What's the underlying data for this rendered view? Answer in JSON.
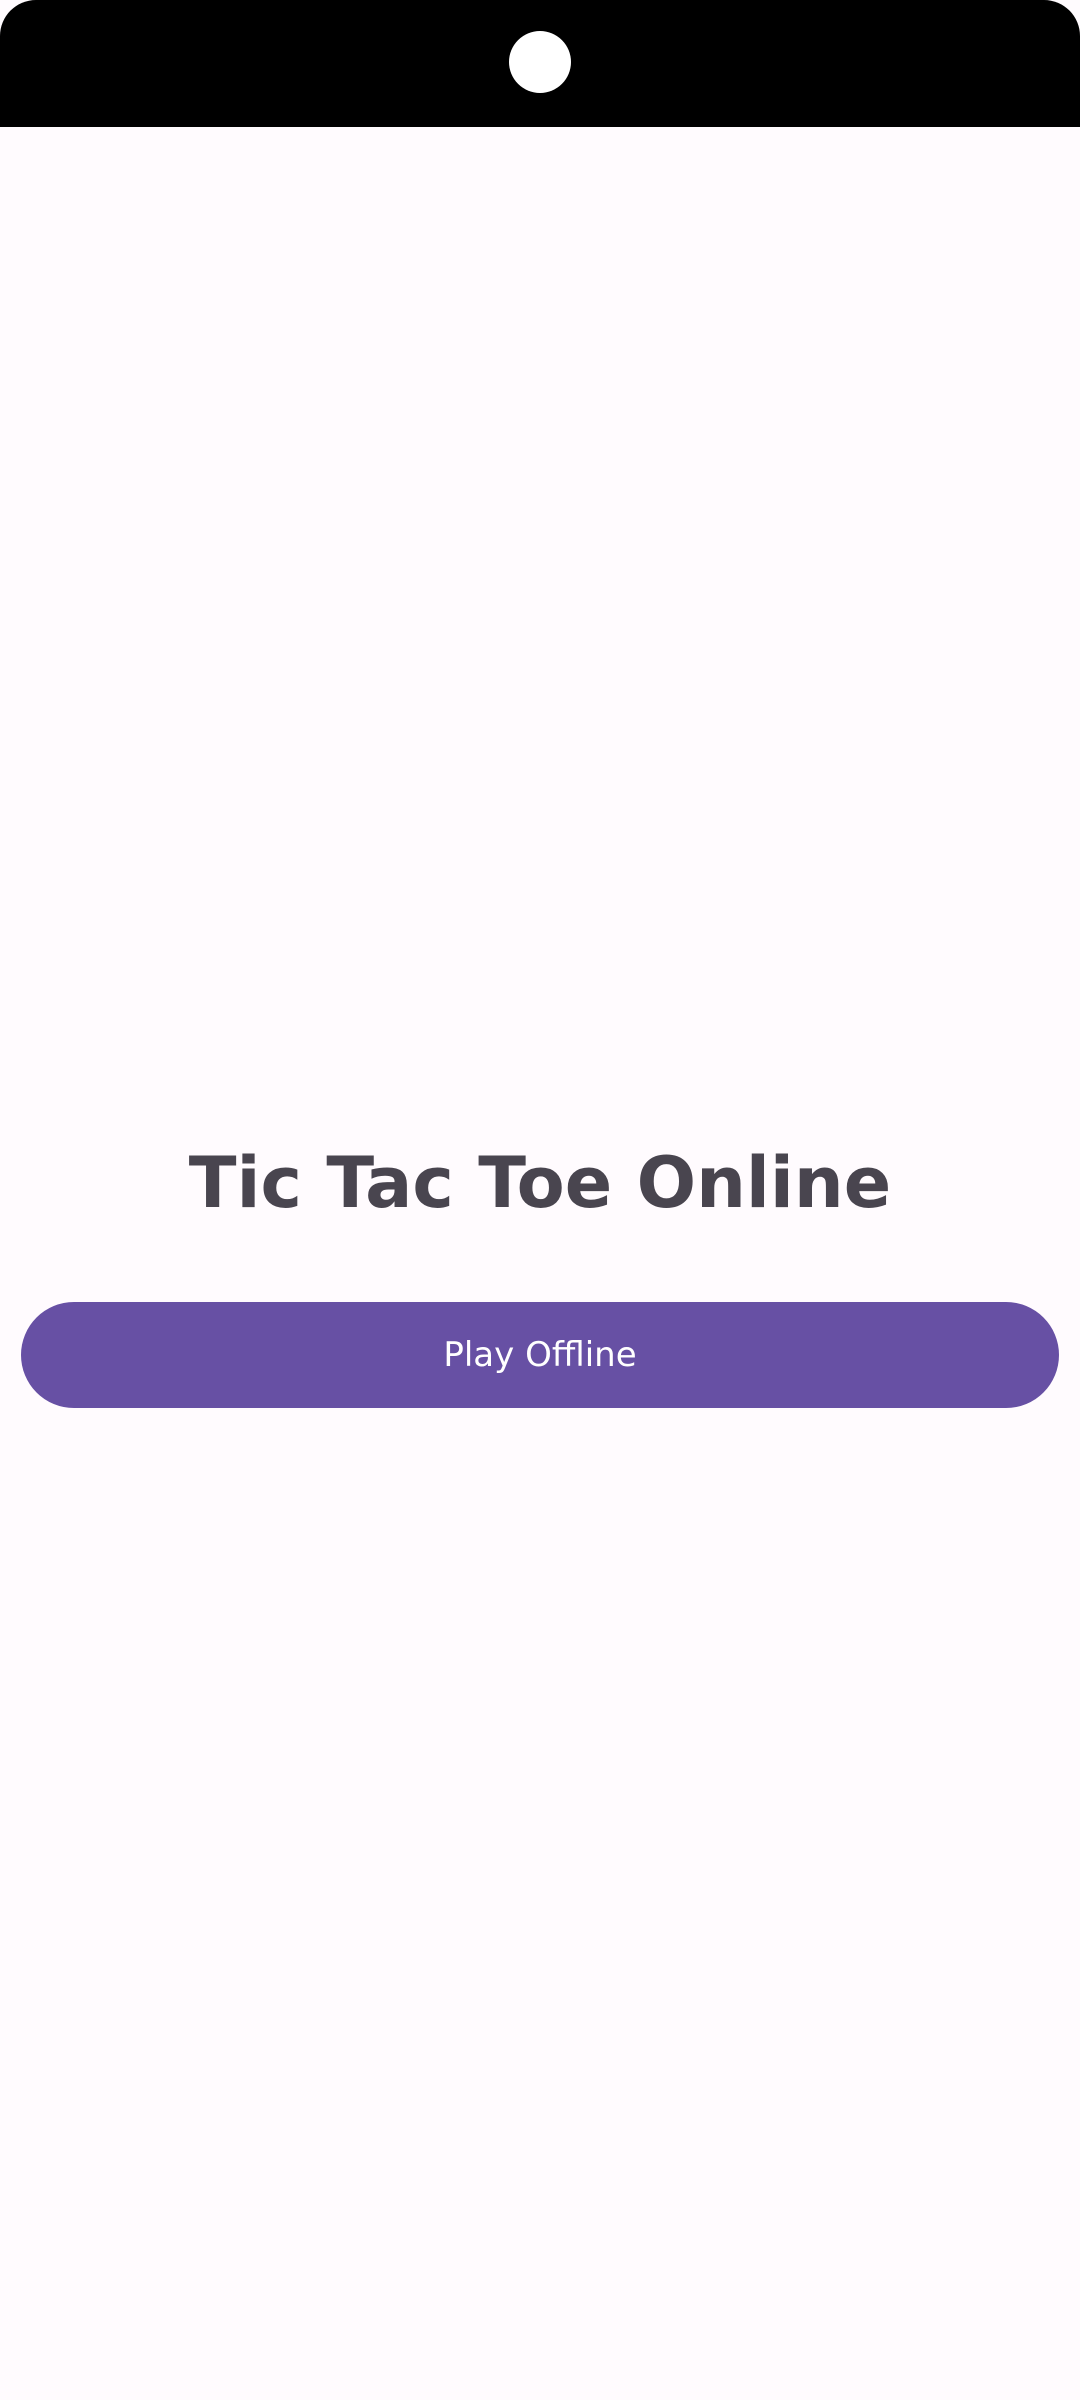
{
  "app": {
    "title": "Tic Tac Toe Online"
  },
  "actions": {
    "play_offline_label": "Play Offline"
  },
  "icons": {
    "camera": "camera-cutout-icon"
  },
  "colors": {
    "background": "#fffbfe",
    "status_bar": "#000000",
    "title_text": "#49454f",
    "primary_button": "#6750a4",
    "button_text": "#ffffff"
  }
}
